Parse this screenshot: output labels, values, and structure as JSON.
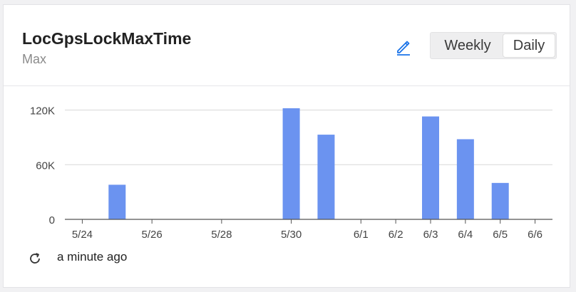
{
  "card": {
    "title": "LocGpsLockMaxTime",
    "subtitle": "Max",
    "edit_icon": "pencil-icon",
    "toggle": {
      "weekly_label": "Weekly",
      "daily_label": "Daily",
      "selected": "Daily"
    },
    "footer": {
      "refresh_icon": "refresh-icon",
      "updated_text": "a minute ago"
    }
  },
  "colors": {
    "bar": "#6b93f0",
    "edit_icon": "#1a73e8",
    "grid": "#d8d8d8",
    "axis": "#555555"
  },
  "chart_data": {
    "type": "bar",
    "categories": [
      "5/24",
      "5/25",
      "5/26",
      "5/27",
      "5/28",
      "5/29",
      "5/30",
      "5/31",
      "6/1",
      "6/2",
      "6/3",
      "6/4",
      "6/5",
      "6/6"
    ],
    "x_tick_labels": [
      "5/24",
      "5/26",
      "5/28",
      "5/30",
      "6/1",
      "6/2",
      "6/3",
      "6/4",
      "6/5",
      "6/6"
    ],
    "values": [
      0,
      38000,
      0,
      0,
      0,
      0,
      122000,
      93000,
      0,
      0,
      113000,
      88000,
      40000,
      0
    ],
    "y_ticks": [
      0,
      60000,
      120000
    ],
    "y_tick_labels": [
      "0",
      "60K",
      "120K"
    ],
    "ylim": [
      0,
      122000
    ],
    "grid": true
  }
}
